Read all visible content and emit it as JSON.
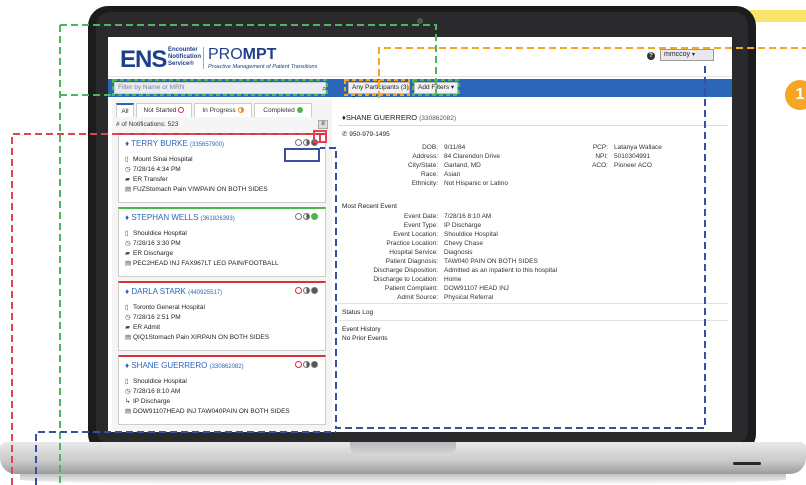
{
  "header": {
    "logo_ens": "ENS",
    "logo_sub": "Encounter Notification Service®",
    "logo_prompt_a": "PRO",
    "logo_prompt_b": "MPT",
    "logo_tagline": "Proactive Management of Patient Transitions",
    "user": "mmccoy"
  },
  "toolbar": {
    "search_placeholder": "Filter by Name or MRN",
    "participants_label": "Any Participants (3) ÷",
    "filters_label": "Add Filters ▾"
  },
  "tabs": [
    {
      "label": "All"
    },
    {
      "label": "Not Started"
    },
    {
      "label": "In Progress"
    },
    {
      "label": "Completed"
    }
  ],
  "notifications_count": "# of Notifications: 523",
  "cards": [
    {
      "name": "TERRY BURKE",
      "mrn": "(335657900)",
      "facility": "Mount Sinai Hospital",
      "time": "7/28/16 4:34 PM",
      "event": "ER Transfer",
      "diagnosis": "FUZStomach Pain VIWPAIN ON BOTH SIDES",
      "color": "#d8323a"
    },
    {
      "name": "STEPHAN WELLS",
      "mrn": "(361826393)",
      "facility": "Shouldice Hospital",
      "time": "7/28/16 3:30 PM",
      "event": "ER Discharge",
      "diagnosis": "PEC2HEAD INJ FAX967LT LEG PAIN/FOOTBALL",
      "color": "#48b84a"
    },
    {
      "name": "DARLA STARK",
      "mrn": "(440925517)",
      "facility": "Toronto General Hospital",
      "time": "7/28/16 2:51 PM",
      "event": "ER Admit",
      "diagnosis": "QIQ1Stomach Pain XIRPAIN ON BOTH SIDES",
      "color": "#d8323a"
    },
    {
      "name": "SHANE GUERRERO",
      "mrn": "(330862082)",
      "facility": "Shouldice Hospital",
      "time": "7/28/16 8:10 AM",
      "event": "IP Discharge",
      "diagnosis": "DOW91107HEAD INJ TAW040PAIN ON BOTH SIDES",
      "color": "#d8323a"
    }
  ],
  "detail": {
    "name": "SHANE GUERRERO",
    "mrn": "(330862082)",
    "phone": "950-979-1495",
    "demographics": [
      {
        "label": "DOB:",
        "value": "9/11/84"
      },
      {
        "label": "Address:",
        "value": "84 Clarendon Drive"
      },
      {
        "label": "City/State:",
        "value": "Garland, MD"
      },
      {
        "label": "Race:",
        "value": "Asian"
      },
      {
        "label": "Ethnicity:",
        "value": "Not Hispanic or Latino"
      }
    ],
    "providers": [
      {
        "label": "PCP:",
        "value": "Latanya Wallace"
      },
      {
        "label": "NPI:",
        "value": "5010304991"
      },
      {
        "label": "ACO:",
        "value": "Pioneer ACO"
      }
    ],
    "recent_event_title": "Most Recent Event",
    "recent_event": [
      {
        "label": "Event Date:",
        "value": "7/28/16 8:10 AM"
      },
      {
        "label": "Event Type:",
        "value": "IP Discharge"
      },
      {
        "label": "Event Location:",
        "value": "Shouldice Hospital"
      },
      {
        "label": "Practice Location:",
        "value": "Chevy Chase"
      },
      {
        "label": "Hospital Service:",
        "value": "Diagnosis"
      },
      {
        "label": "Patient Diagnosis:",
        "value": "TAW040 PAIN ON BOTH SIDES"
      },
      {
        "label": "Discharge Disposition:",
        "value": "Admitted as an inpatient to this hospital"
      },
      {
        "label": "Discharge to Location:",
        "value": "Home"
      },
      {
        "label": "Patient Complaint:",
        "value": "DOW91107 HEAD INJ"
      },
      {
        "label": "Admit Source:",
        "value": "Physical Referral"
      }
    ],
    "status_log": "Status Log",
    "event_history": "Event History",
    "no_prior": "No Prior Events"
  },
  "badge_number": "1"
}
